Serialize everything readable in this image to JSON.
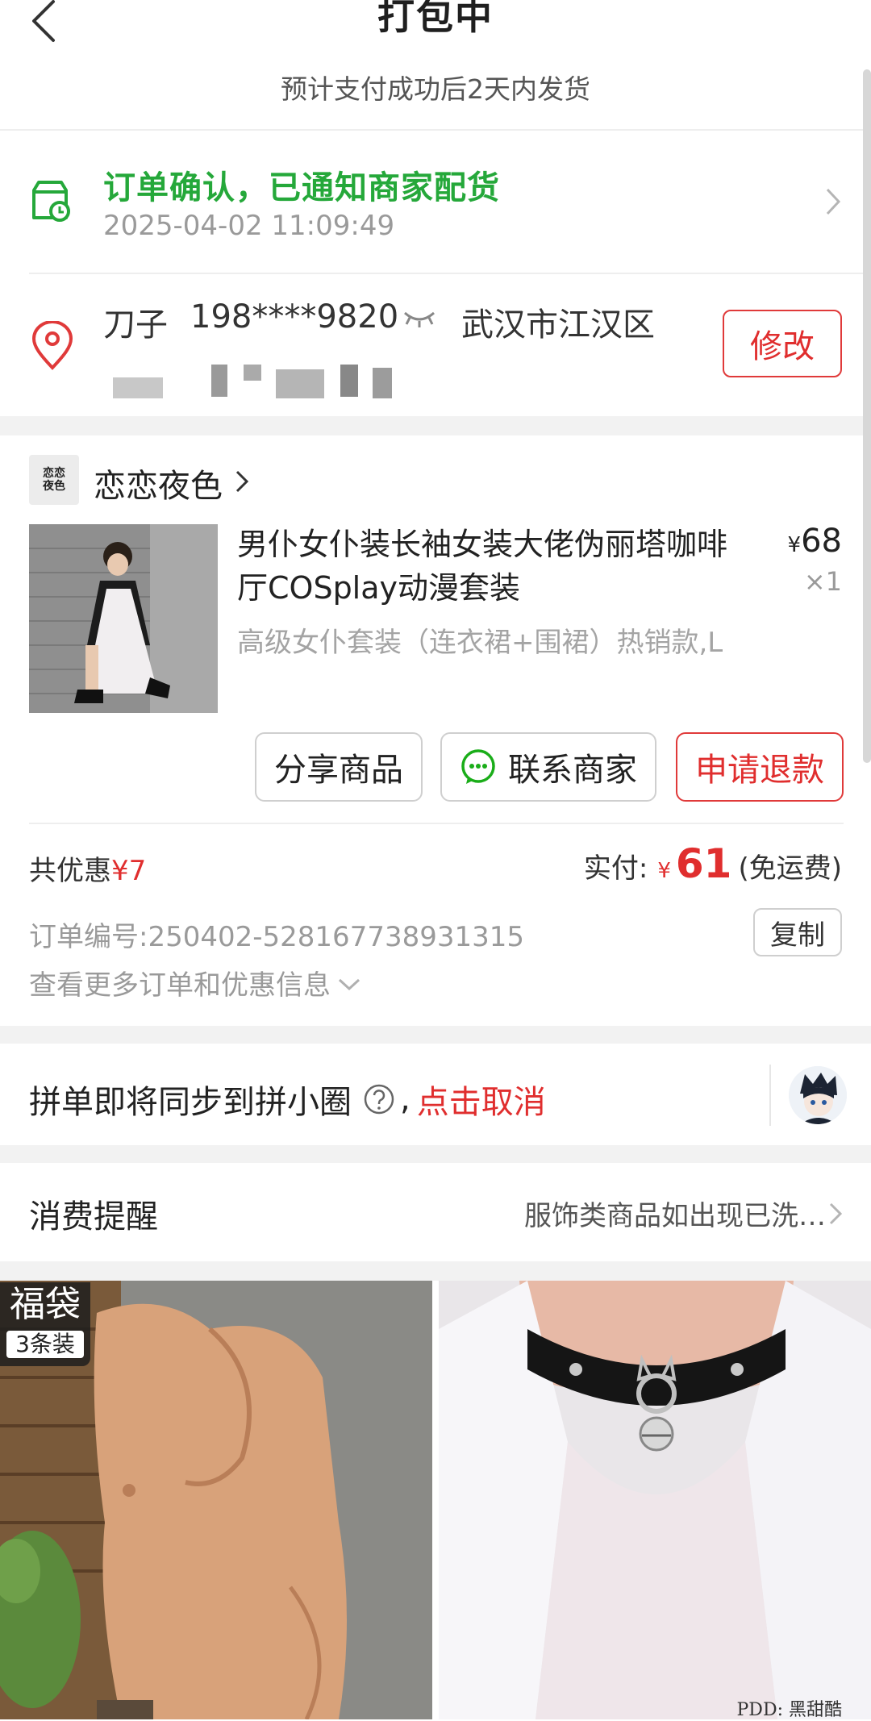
{
  "header": {
    "title": "打包中",
    "ship_hint": "预计支付成功后2天内发货"
  },
  "status": {
    "text": "订单确认，已通知商家配货",
    "time": "2025-04-02 11:09:49"
  },
  "address": {
    "name": "刀子",
    "phone": "198****9820",
    "city": "武汉市江汉区",
    "edit_label": "修改"
  },
  "store": {
    "logo_text": "恋恋夜色",
    "name": "恋恋夜色"
  },
  "product": {
    "title": "男仆女仆装长袖女装大佬伪丽塔咖啡厅COSplay动漫套装",
    "currency": "¥",
    "price": "68",
    "qty": "×1",
    "spec": "高级女仆套装（连衣裙+围裙）热销款,L"
  },
  "actions": {
    "share": "分享商品",
    "contact": "联系商家",
    "refund": "申请退款"
  },
  "totals": {
    "discount_label": "共优惠",
    "discount_value": "¥7",
    "paid_label": "实付:",
    "paid_currency": "¥",
    "paid_amount": "61",
    "paid_note": "(免运费)"
  },
  "order": {
    "number_label": "订单编号:",
    "number": "250402-528167738931315",
    "copy_label": "复制",
    "more_label": "查看更多订单和优惠信息"
  },
  "group": {
    "text": "拼单即将同步到拼小圈",
    "comma": ",",
    "cancel": "点击取消"
  },
  "reminder": {
    "title": "消费提醒",
    "note": "服饰类商品如出现已洗…"
  },
  "recommend": {
    "badge_title": "福袋",
    "badge_sub": "3条装",
    "watermark": "PDD: 黑甜酷"
  },
  "colors": {
    "green": "#25a83a",
    "red": "#e02e2e",
    "gray_text": "#9a9a9a",
    "wechat_green": "#1aad19"
  }
}
